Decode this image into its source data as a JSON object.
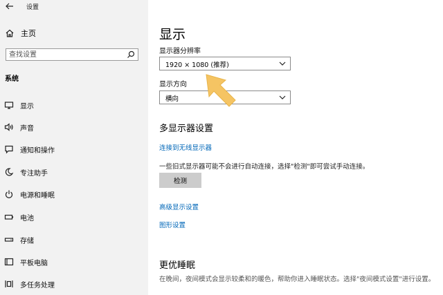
{
  "window": {
    "title": "设置"
  },
  "sidebar": {
    "home_label": "主页",
    "search_placeholder": "查找设置",
    "section_title": "系统",
    "items": [
      {
        "label": "显示",
        "icon": "monitor-icon"
      },
      {
        "label": "声音",
        "icon": "speaker-icon"
      },
      {
        "label": "通知和操作",
        "icon": "notification-icon"
      },
      {
        "label": "专注助手",
        "icon": "moon-icon"
      },
      {
        "label": "电源和睡眠",
        "icon": "power-icon"
      },
      {
        "label": "电池",
        "icon": "battery-icon"
      },
      {
        "label": "存储",
        "icon": "storage-icon"
      },
      {
        "label": "平板电脑",
        "icon": "tablet-icon"
      },
      {
        "label": "多任务处理",
        "icon": "multitask-icon"
      }
    ]
  },
  "main": {
    "title": "显示",
    "resolution_label": "显示器分辨率",
    "resolution_value": "1920 × 1080 (推荐)",
    "orientation_label": "显示方向",
    "orientation_value": "横向",
    "multi_display_title": "多显示器设置",
    "wireless_link": "连接到无线显示器",
    "detect_desc": "一些旧式显示器可能不会进行自动连接，选择\"检测\"即可尝试手动连接。",
    "detect_button": "检测",
    "advanced_link": "高级显示设置",
    "graphics_link": "图形设置",
    "night_title": "更优睡眠",
    "night_desc": "在晚间，夜间模式会显示较柔和的暖色，帮助你进入睡眠状态。选择\"夜间模式设置\"进行设置。"
  },
  "colors": {
    "sidebar_bg": "#f2f2f2",
    "link": "#0067b8",
    "button_bg": "#cccccc",
    "annotation_arrow": "#f5c463"
  }
}
